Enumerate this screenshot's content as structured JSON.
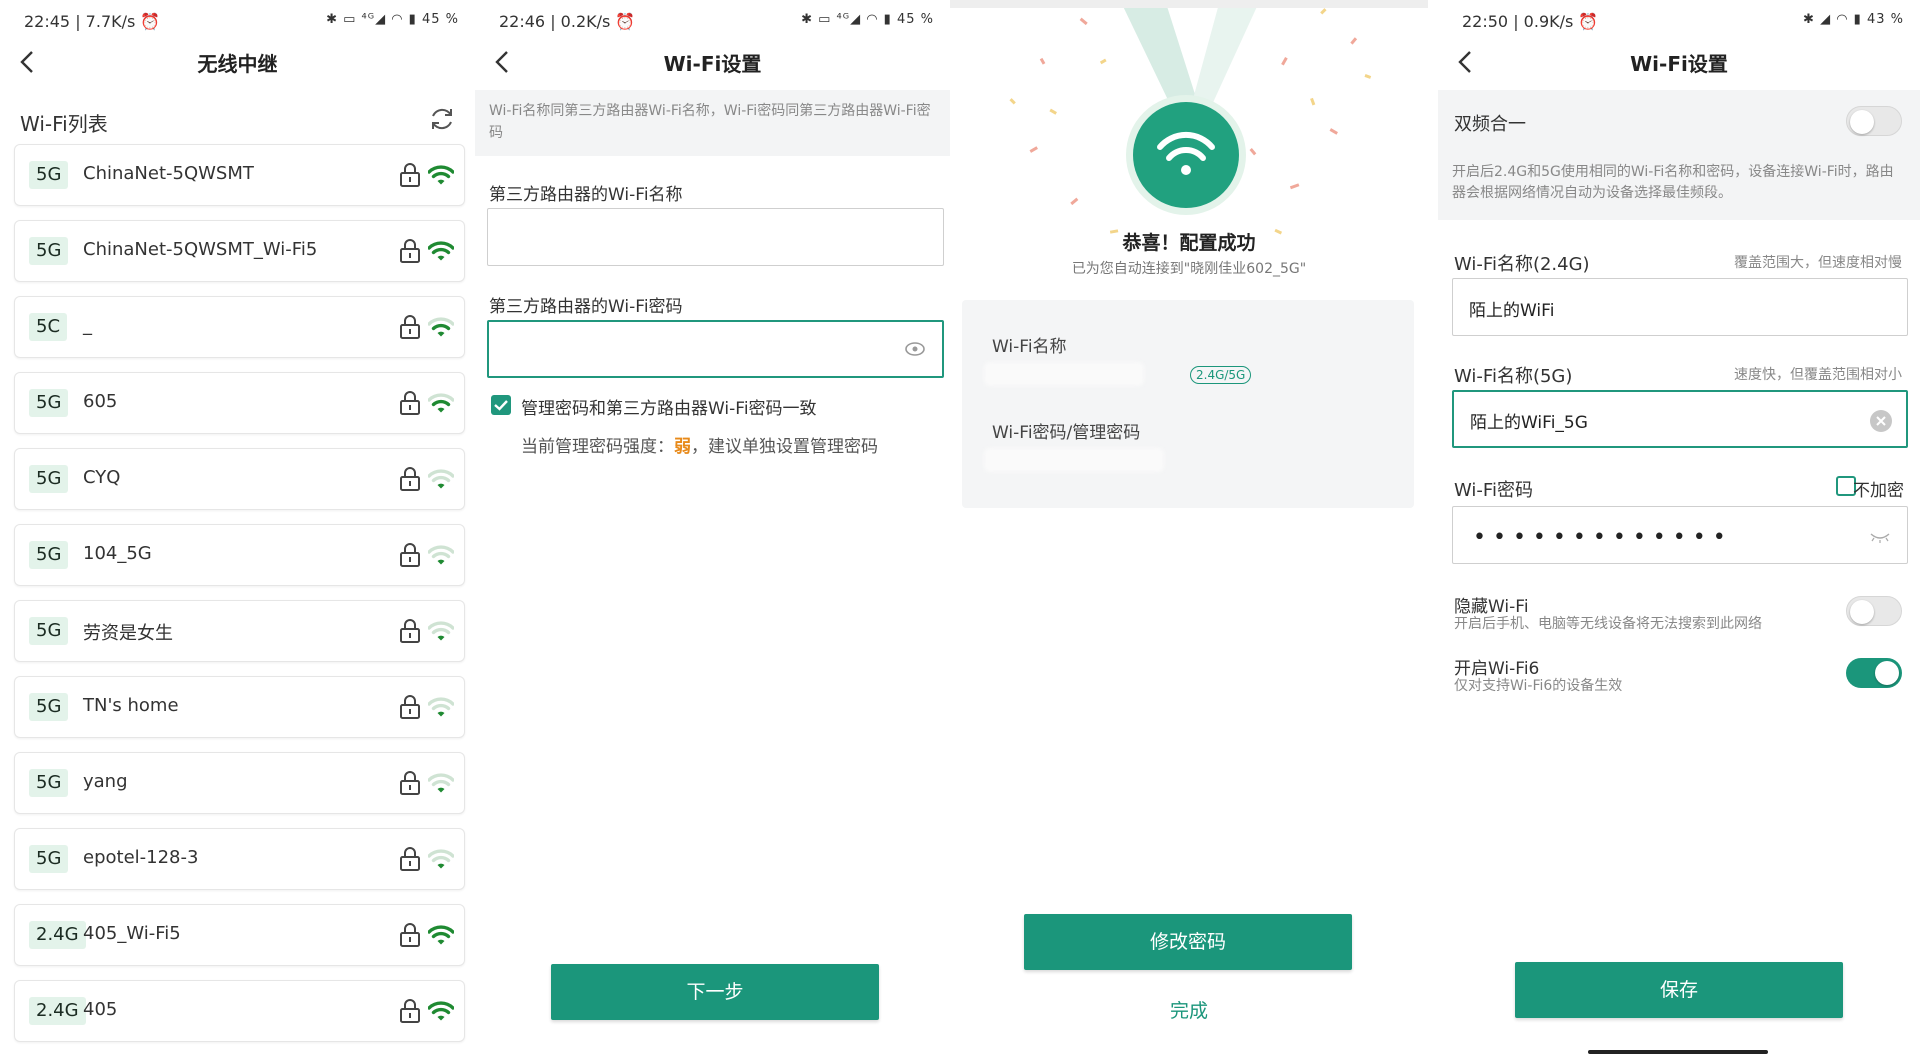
{
  "colors": {
    "accent": "#1b967b",
    "band_bg": "#e3f3ea",
    "weak": "#e88a1a"
  },
  "panel1": {
    "status": {
      "time": "22:45 | 7.7K/s ⏰",
      "sys": "✱ ▭ ⁴ᴳ◢ ◠ ▮ 45 %"
    },
    "title": "无线中继",
    "list_label": "Wi-Fi列表",
    "networks": [
      {
        "band": "5G",
        "ssid": "ChinaNet-5QWSMT",
        "signal": "strong"
      },
      {
        "band": "5G",
        "ssid": "ChinaNet-5QWSMT_Wi-Fi5",
        "signal": "strong"
      },
      {
        "band": "5C",
        "ssid": "_",
        "signal": "medium"
      },
      {
        "band": "5G",
        "ssid": "605",
        "signal": "medium"
      },
      {
        "band": "5G",
        "ssid": "CYQ",
        "signal": "weak"
      },
      {
        "band": "5G",
        "ssid": "104_5G",
        "signal": "weak"
      },
      {
        "band": "5G",
        "ssid": "劳资是女生",
        "signal": "weak"
      },
      {
        "band": "5G",
        "ssid": "TN's home",
        "signal": "weak"
      },
      {
        "band": "5G",
        "ssid": "yang",
        "signal": "weak"
      },
      {
        "band": "5G",
        "ssid": "epotel-128-3",
        "signal": "weak"
      },
      {
        "band": "2.4G",
        "ssid": "405_Wi-Fi5",
        "signal": "strong"
      },
      {
        "band": "2.4G",
        "ssid": "405",
        "signal": "strong"
      }
    ]
  },
  "panel2": {
    "status": {
      "time": "22:46 | 0.2K/s ⏰",
      "sys": "✱ ▭ ⁴ᴳ◢ ◠ ▮ 45 %"
    },
    "title": "Wi-Fi设置",
    "hint": "Wi-Fi名称同第三方路由器Wi-Fi名称，Wi-Fi密码同第三方路由器Wi-Fi密码",
    "ssid_label": "第三方路由器的Wi-Fi名称",
    "ssid_value": "",
    "pwd_label": "第三方路由器的Wi-Fi密码",
    "pwd_value": "",
    "same_pwd_label": "管理密码和第三方路由器Wi-Fi密码一致",
    "strength_prefix": "当前管理密码强度：",
    "strength_value": "弱",
    "strength_suffix": "，建议单独设置管理密码",
    "next_button": "下一步"
  },
  "panel3": {
    "title": "恭喜！配置成功",
    "subtitle": "已为您自动连接到\"晓刚佳业602_5G\"",
    "ssid_label": "Wi-Fi名称",
    "band_tag": "2.4G/5G",
    "pwd_label": "Wi-Fi密码/管理密码",
    "change_pwd_button": "修改密码",
    "done_button": "完成"
  },
  "panel4": {
    "status": {
      "time": "22:50 | 0.9K/s ⏰",
      "sys": "✱ ◢ ◠ ▮ 43 %"
    },
    "title": "Wi-Fi设置",
    "dual_band_label": "双频合一",
    "dual_band_on": false,
    "dual_band_note": "开启后2.4G和5G使用相同的Wi-Fi名称和密码，设备连接Wi-Fi时，路由器会根据网络情况自动为设备选择最佳频段。",
    "ssid24_label": "Wi-Fi名称(2.4G)",
    "ssid24_note": "覆盖范围大，但速度相对慢",
    "ssid24_value": "陌上的WiFi",
    "ssid5_label": "Wi-Fi名称(5G)",
    "ssid5_note": "速度快，但覆盖范围相对小",
    "ssid5_value": "陌上的WiFi_5G",
    "pwd_label": "Wi-Fi密码",
    "no_encrypt_label": "不加密",
    "no_encrypt_checked": false,
    "pwd_value": "•••••••••••••",
    "hidden_label": "隐藏Wi-Fi",
    "hidden_note": "开启后手机、电脑等无线设备将无法搜索到此网络",
    "hidden_on": false,
    "wifi6_label": "开启Wi-Fi6",
    "wifi6_note": "仅对支持Wi-Fi6的设备生效",
    "wifi6_on": true,
    "save_button": "保存"
  }
}
